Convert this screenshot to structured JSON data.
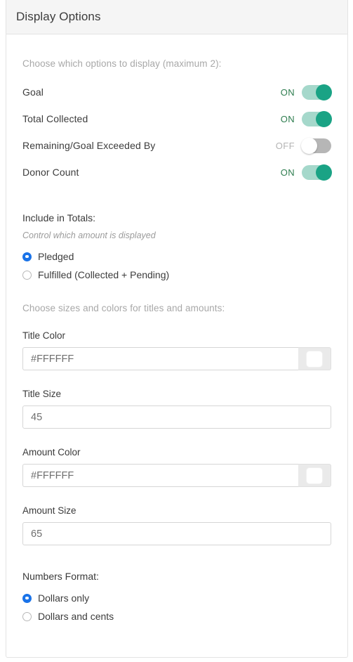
{
  "header": {
    "title": "Display Options"
  },
  "display_options": {
    "helper": "Choose which options to display (maximum 2):",
    "items": [
      {
        "label": "Goal",
        "state": "ON",
        "on": true
      },
      {
        "label": "Total Collected",
        "state": "ON",
        "on": true
      },
      {
        "label": "Remaining/Goal Exceeded By",
        "state": "OFF",
        "on": false
      },
      {
        "label": "Donor Count",
        "state": "ON",
        "on": true
      }
    ]
  },
  "include_in_totals": {
    "label": "Include in Totals:",
    "sub": "Control which amount is displayed",
    "options": [
      {
        "label": "Pledged",
        "checked": true
      },
      {
        "label": "Fulfilled (Collected + Pending)",
        "checked": false
      }
    ]
  },
  "appearance": {
    "helper": "Choose sizes and colors for titles and amounts:",
    "title_color": {
      "label": "Title Color",
      "value": "#FFFFFF",
      "swatch": "#FFFFFF"
    },
    "title_size": {
      "label": "Title Size",
      "value": "45"
    },
    "amount_color": {
      "label": "Amount Color",
      "value": "#FFFFFF",
      "swatch": "#FFFFFF"
    },
    "amount_size": {
      "label": "Amount Size",
      "value": "65"
    }
  },
  "numbers_format": {
    "label": "Numbers Format:",
    "options": [
      {
        "label": "Dollars only",
        "checked": true
      },
      {
        "label": "Dollars and cents",
        "checked": false
      }
    ]
  },
  "colors": {
    "toggle_on_track": "#a5d8cb",
    "toggle_on_knob": "#1aa385",
    "toggle_off_track": "#b6b6b6",
    "on_text": "#2e7d4f",
    "off_text": "#b4b4b4",
    "radio_accent": "#1a73e8",
    "header_bg": "#f5f5f5",
    "border": "#e3e3e3"
  }
}
